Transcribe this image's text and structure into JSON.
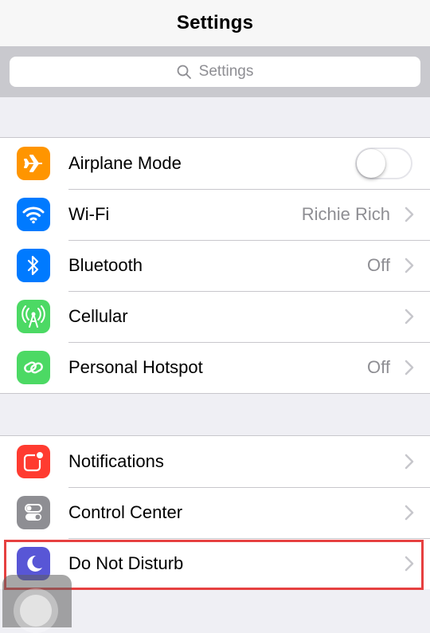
{
  "navbar": {
    "title": "Settings"
  },
  "search": {
    "placeholder": "Settings"
  },
  "groups": [
    {
      "rows": [
        {
          "label": "Airplane Mode",
          "icon": "airplane-icon",
          "color": "#ff9500",
          "control": "toggle",
          "toggle_on": false
        },
        {
          "label": "Wi-Fi",
          "icon": "wifi-icon",
          "color": "#007aff",
          "value": "Richie Rich"
        },
        {
          "label": "Bluetooth",
          "icon": "bluetooth-icon",
          "color": "#007aff",
          "value": "Off"
        },
        {
          "label": "Cellular",
          "icon": "cellular-antenna-icon",
          "color": "#4cd964"
        },
        {
          "label": "Personal Hotspot",
          "icon": "hotspot-link-icon",
          "color": "#4cd964",
          "value": "Off"
        }
      ]
    },
    {
      "rows": [
        {
          "label": "Notifications",
          "icon": "notifications-icon",
          "color": "#ff3b30"
        },
        {
          "label": "Control Center",
          "icon": "control-center-icon",
          "color": "#8e8e93"
        },
        {
          "label": "Do Not Disturb",
          "icon": "moon-icon",
          "color": "#5856d6",
          "highlighted": true
        }
      ]
    }
  ],
  "colors": {
    "highlight": "#e64040",
    "separator": "#c8c7cc",
    "background": "#efeff4"
  }
}
